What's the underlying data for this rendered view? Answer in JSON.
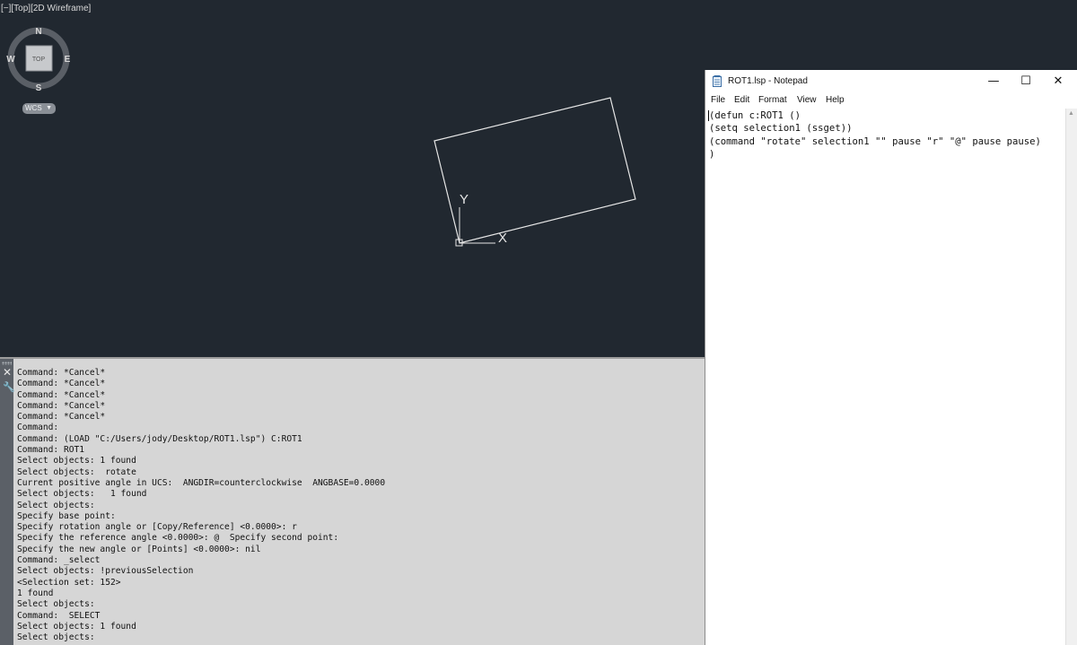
{
  "viewport": {
    "label": "[−][Top][2D Wireframe]",
    "viewcube": {
      "north": "N",
      "south": "S",
      "east": "E",
      "west": "W",
      "face": "TOP"
    },
    "wcs_label": "WCS",
    "ucs_x_label": "X",
    "ucs_y_label": "Y"
  },
  "command_history": [
    "Command: *Cancel*",
    "Command: *Cancel*",
    "Command: *Cancel*",
    "Command: *Cancel*",
    "Command: *Cancel*",
    "Command:",
    "Command: (LOAD \"C:/Users/jody/Desktop/ROT1.lsp\") C:ROT1",
    "Command: ROT1",
    "Select objects: 1 found",
    "Select objects:  rotate",
    "Current positive angle in UCS:  ANGDIR=counterclockwise  ANGBASE=0.0000",
    "Select objects:   1 found",
    "Select objects:",
    "Specify base point:",
    "Specify rotation angle or [Copy/Reference] <0.0000>: r",
    "Specify the reference angle <0.0000>: @  Specify second point:",
    "Specify the new angle or [Points] <0.0000>: nil",
    "Command: _select",
    "Select objects: !previousSelection",
    "<Selection set: 152>",
    "1 found",
    "Select objects:",
    "Command:  SELECT",
    "Select objects: 1 found",
    "Select objects:"
  ],
  "notepad": {
    "title": "ROT1.lsp - Notepad",
    "controls": {
      "minimize": "—",
      "maximize": "☐",
      "close": "✕"
    },
    "menu": [
      "File",
      "Edit",
      "Format",
      "View",
      "Help"
    ],
    "code": [
      "(defun c:ROT1 ()",
      "(setq selection1 (ssget))",
      "(command \"rotate\" selection1 \"\" pause \"r\" \"@\" pause pause)",
      ")"
    ]
  },
  "colors": {
    "viewport_bg": "#212830",
    "command_bg": "#d6d6d6",
    "wire": "#e6e6e6"
  }
}
